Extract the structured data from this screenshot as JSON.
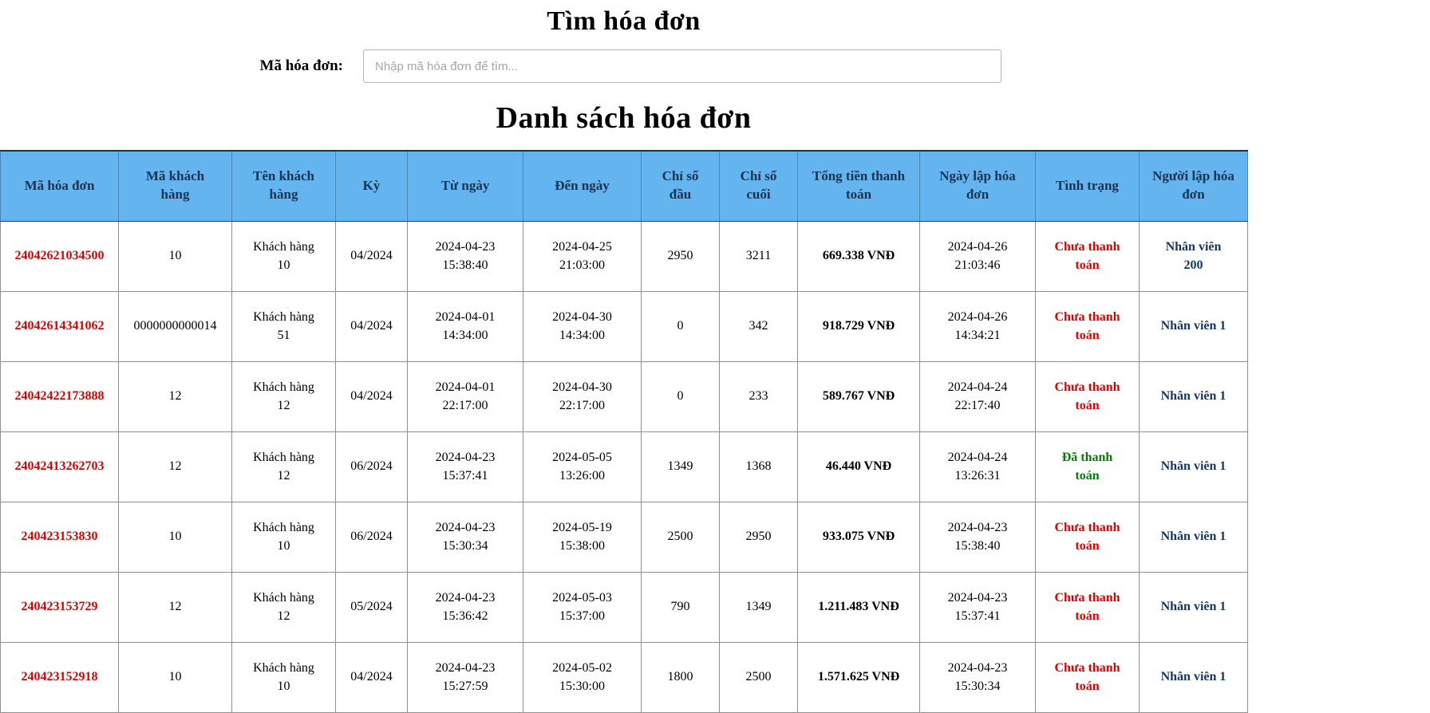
{
  "page": {
    "search_title": "Tìm hóa đơn",
    "search_label": "Mã hóa đơn:",
    "search_placeholder": "Nhập mã hóa đơn để tìm...",
    "list_title": "Danh sách hóa đơn"
  },
  "colors": {
    "header_bg": "#63b4ef",
    "header_text": "#1c3350",
    "invoice_code": "#e00000",
    "status_unpaid": "#e00000",
    "status_paid": "#008000",
    "creator_text": "#16365c"
  },
  "table": {
    "headers": [
      "Mã hóa đơn",
      "Mã khách\nhàng",
      "Tên khách\nhàng",
      "Kỳ",
      "Từ ngày",
      "Đến ngày",
      "Chỉ số\nđầu",
      "Chỉ số\ncuối",
      "Tổng tiền thanh\ntoán",
      "Ngày lập hóa\nđơn",
      "Tình trạng",
      "Người lập hóa\nđơn"
    ],
    "columns": [
      {
        "key": "code",
        "style": "code",
        "name": "cell-invoice-code",
        "interactable": "true"
      },
      {
        "key": "customer_code",
        "style": "",
        "name": "cell-customer-code",
        "interactable": "false"
      },
      {
        "key": "customer_name",
        "style": "",
        "name": "cell-customer-name",
        "interactable": "false"
      },
      {
        "key": "period",
        "style": "",
        "name": "cell-period",
        "interactable": "false"
      },
      {
        "key": "from_date",
        "style": "",
        "name": "cell-from-date",
        "interactable": "false"
      },
      {
        "key": "to_date",
        "style": "",
        "name": "cell-to-date",
        "interactable": "false"
      },
      {
        "key": "start_index",
        "style": "",
        "name": "cell-start-index",
        "interactable": "false"
      },
      {
        "key": "end_index",
        "style": "",
        "name": "cell-end-index",
        "interactable": "false"
      },
      {
        "key": "total",
        "style": "total",
        "name": "cell-total-amount",
        "interactable": "false"
      },
      {
        "key": "created_date",
        "style": "",
        "name": "cell-created-date",
        "interactable": "false"
      },
      {
        "key": "status",
        "style": "status",
        "name": "cell-status",
        "interactable": "false"
      },
      {
        "key": "creator",
        "style": "creator",
        "name": "cell-creator",
        "interactable": "false"
      }
    ],
    "rows": [
      {
        "code": "24042621034500",
        "customer_code": "10",
        "customer_name": "Khách hàng\n10",
        "period": "04/2024",
        "from_date": "2024-04-23\n15:38:40",
        "to_date": "2024-04-25\n21:03:00",
        "start_index": "2950",
        "end_index": "3211",
        "total": "669.338 VNĐ",
        "created_date": "2024-04-26\n21:03:46",
        "status": "Chưa thanh\ntoán",
        "status_paid": false,
        "creator": "Nhân viên\n200"
      },
      {
        "code": "24042614341062",
        "customer_code": "0000000000014",
        "customer_name": "Khách hàng\n51",
        "period": "04/2024",
        "from_date": "2024-04-01\n14:34:00",
        "to_date": "2024-04-30\n14:34:00",
        "start_index": "0",
        "end_index": "342",
        "total": "918.729 VNĐ",
        "created_date": "2024-04-26\n14:34:21",
        "status": "Chưa thanh\ntoán",
        "status_paid": false,
        "creator": "Nhân viên 1"
      },
      {
        "code": "24042422173888",
        "customer_code": "12",
        "customer_name": "Khách hàng\n12",
        "period": "04/2024",
        "from_date": "2024-04-01\n22:17:00",
        "to_date": "2024-04-30\n22:17:00",
        "start_index": "0",
        "end_index": "233",
        "total": "589.767 VNĐ",
        "created_date": "2024-04-24\n22:17:40",
        "status": "Chưa thanh\ntoán",
        "status_paid": false,
        "creator": "Nhân viên 1"
      },
      {
        "code": "24042413262703",
        "customer_code": "12",
        "customer_name": "Khách hàng\n12",
        "period": "06/2024",
        "from_date": "2024-04-23\n15:37:41",
        "to_date": "2024-05-05\n13:26:00",
        "start_index": "1349",
        "end_index": "1368",
        "total": "46.440 VNĐ",
        "created_date": "2024-04-24\n13:26:31",
        "status": "Đã thanh\ntoán",
        "status_paid": true,
        "creator": "Nhân viên 1"
      },
      {
        "code": "240423153830",
        "customer_code": "10",
        "customer_name": "Khách hàng\n10",
        "period": "06/2024",
        "from_date": "2024-04-23\n15:30:34",
        "to_date": "2024-05-19\n15:38:00",
        "start_index": "2500",
        "end_index": "2950",
        "total": "933.075 VNĐ",
        "created_date": "2024-04-23\n15:38:40",
        "status": "Chưa thanh\ntoán",
        "status_paid": false,
        "creator": "Nhân viên 1"
      },
      {
        "code": "240423153729",
        "customer_code": "12",
        "customer_name": "Khách hàng\n12",
        "period": "05/2024",
        "from_date": "2024-04-23\n15:36:42",
        "to_date": "2024-05-03\n15:37:00",
        "start_index": "790",
        "end_index": "1349",
        "total": "1.211.483 VNĐ",
        "created_date": "2024-04-23\n15:37:41",
        "status": "Chưa thanh\ntoán",
        "status_paid": false,
        "creator": "Nhân viên 1"
      },
      {
        "code": "240423152918",
        "customer_code": "10",
        "customer_name": "Khách hàng\n10",
        "period": "04/2024",
        "from_date": "2024-04-23\n15:27:59",
        "to_date": "2024-05-02\n15:30:00",
        "start_index": "1800",
        "end_index": "2500",
        "total": "1.571.625 VNĐ",
        "created_date": "2024-04-23\n15:30:34",
        "status": "Chưa thanh\ntoán",
        "status_paid": false,
        "creator": "Nhân viên 1"
      }
    ]
  }
}
